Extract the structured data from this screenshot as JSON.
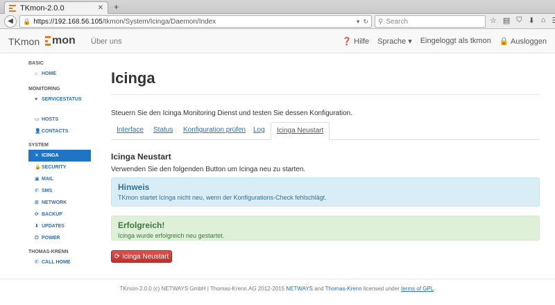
{
  "browser": {
    "tab_title": "TKmon-2.0.0",
    "tab_close": "✕",
    "new_tab": "+",
    "url_prefix": "https://192.168.56.105",
    "url_path": "/tkmon/System/Icinga/Daemon/Index",
    "search_placeholder": "Search"
  },
  "header": {
    "brand": "TKmon",
    "logo_text": "mon",
    "about": "Über uns",
    "help": "Hilfe",
    "language": "Sprache",
    "logged_in": "Eingeloggt als tkmon",
    "logout": "Ausloggen"
  },
  "sidebar": {
    "basic": "BASIC",
    "home": "HOME",
    "monitoring": "MONITORING",
    "servicestatus": "SERVICESTATUS",
    "hosts": "HOSTS",
    "contacts": "CONTACTS",
    "system": "SYSTEM",
    "icinga": "ICINGA",
    "security": "SECURITY",
    "mail": "MAIL",
    "sms": "SMS",
    "network": "NETWORK",
    "backup": "BACKUP",
    "updates": "UPDATES",
    "power": "POWER",
    "thomas_krenn": "THOMAS-KRENN",
    "call_home": "CALL HOME"
  },
  "main": {
    "title": "Icinga",
    "description": "Steuern Sie den Icinga Monitoring Dienst und testen Sie dessen Konfiguration.",
    "tabs": [
      "Interface",
      "Status",
      "Konfiguration prüfen",
      "Log",
      "Icinga Neustart"
    ],
    "section_title": "Icinga Neustart",
    "section_desc": "Verwenden Sie den folgenden Button um Icinga neu zu starten.",
    "info_title": "Hinweis",
    "info_text": "TKmon startet Icinga nicht neu, wenn der Konfigurations-Check fehlschlägt.",
    "success_title": "Erfolgreich!",
    "success_text": "Icinga wurde erfolgreich neu gestartet.",
    "restart_button": "Icinga Neustart"
  },
  "footer": {
    "prefix": "TKmon-2.0.0 (c) NETWAYS GmbH | Thomas-Krenn.AG 2012-2015",
    "netways": "NETWAYS",
    "and": "and",
    "thomas_krenn": "Thomas-Krenn",
    "licensed": "licensed under",
    "gpl": "terms of GPL",
    "period": "."
  },
  "colors": {
    "accent": "#2a6fbb",
    "active_nav": "#1f75c4",
    "danger": "#d9534f",
    "logo_orange": "#e87722"
  }
}
